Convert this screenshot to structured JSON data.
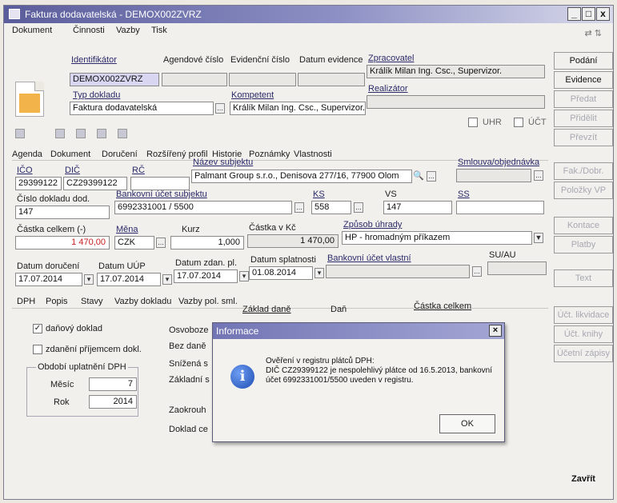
{
  "window": {
    "title": "Faktura dodavatelská - DEMOX002ZVRZ",
    "controls": [
      "_",
      "□",
      "x"
    ]
  },
  "menu": [
    "Dokument",
    "Činnosti",
    "Vazby",
    "Tisk"
  ],
  "header": {
    "identifikator_label": "Identifikátor",
    "identifikator_value": "DEMOX002ZVRZ",
    "agendove_cislo_label": "Agendové číslo",
    "agendove_cislo_value": "",
    "evidencni_cislo_label": "Evidenční číslo",
    "evidencni_cislo_value": "",
    "datum_evidence_label": "Datum evidence",
    "datum_evidence_value": "",
    "zpracovatel_label": "Zpracovatel",
    "zpracovatel_value": "Králík Milan Ing. Csc., Supervizor.",
    "typ_dokladu_label": "Typ dokladu",
    "typ_dokladu_value": "Faktura dodavatelská",
    "kompetent_label": "Kompetent",
    "kompetent_value": "Králík Milan Ing. Csc., Supervizor.",
    "realizator_label": "Realizátor",
    "realizator_value": "",
    "uhr_label": "UHR",
    "uct_label": "ÚČT"
  },
  "right_buttons": [
    {
      "label": "Podání",
      "enabled": true
    },
    {
      "label": "Evidence",
      "enabled": true
    },
    {
      "label": "Předat",
      "enabled": false
    },
    {
      "label": "Přidělit",
      "enabled": false
    },
    {
      "label": "Převzít",
      "enabled": false
    },
    {
      "label": "Fak./Dobr.",
      "enabled": false
    },
    {
      "label": "Položky VP",
      "enabled": false
    },
    {
      "label": "Kontace",
      "enabled": false
    },
    {
      "label": "Platby",
      "enabled": false
    },
    {
      "label": "Text",
      "enabled": false
    },
    {
      "label": "Účt. likvidace",
      "enabled": false
    },
    {
      "label": "Účt. knihy",
      "enabled": false
    },
    {
      "label": "Účetní zápisy",
      "enabled": false
    },
    {
      "label": "Zavřít",
      "enabled": true
    }
  ],
  "tabs": [
    "Agenda",
    "Dokument",
    "Doručení",
    "Rozšířený profil",
    "Historie",
    "Poznámky",
    "Vlastnosti"
  ],
  "form": {
    "ico_label": "IČO",
    "ico_value": "29399122",
    "dic_label": "DIČ",
    "dic_value": "CZ29399122",
    "rc_label": "RČ",
    "rc_value": "",
    "nazev_label": "Název subjektu",
    "nazev_value": "Palmant Group s.r.o., Denisova 277/16, 77900 Olom",
    "smlouva_label": "Smlouva/objednávka",
    "smlouva_value": "",
    "cislo_dokladu_label": "Číslo dokladu dod.",
    "cislo_dokladu_value": "147",
    "bankovni_ucet_label": "Bankovní účet subjektu",
    "bankovni_ucet_value": "6992331001 / 5500",
    "ks_label": "KS",
    "ks_value": "558",
    "vs_label": "VS",
    "vs_value": "147",
    "ss_label": "SS",
    "ss_value": "",
    "castka_celkem_label": "Částka celkem (-)",
    "castka_celkem_value": "1 470,00",
    "mena_label": "Měna",
    "mena_value": "CZK",
    "kurz_label": "Kurz",
    "kurz_value": "1,000",
    "castka_kc_label": "Částka v Kč",
    "castka_kc_value": "1 470,00",
    "zpusob_uhrady_label": "Způsob úhrady",
    "zpusob_uhrady_value": "HP - hromadným příkazem",
    "datum_doruceni_label": "Datum doručení",
    "datum_doruceni_value": "17.07.2014",
    "datum_uup_label": "Datum UÚP",
    "datum_uup_value": "17.07.2014",
    "datum_zdan_label": "Datum zdan. pl.",
    "datum_zdan_value": "17.07.2014",
    "datum_splatnosti_label": "Datum splatnosti",
    "datum_splatnosti_value": "01.08.2014",
    "bankovni_ucet_vlastni_label": "Bankovní účet vlastní",
    "bankovni_ucet_vlastni_value": "",
    "su_au_label": "SU/AU",
    "su_au_value": ""
  },
  "subtabs": [
    "DPH",
    "Popis",
    "Stavy",
    "Vazby dokladu",
    "Vazby pol. sml."
  ],
  "dph": {
    "danovy_doklad_label": "daňový doklad",
    "danovy_doklad_checked": true,
    "zdaneni_label": "zdanění příjemcem dokl.",
    "zdaneni_checked": false,
    "obdobi_label": "Období uplatnění DPH",
    "mesic_label": "Měsíc",
    "mesic_value": "7",
    "rok_label": "Rok",
    "rok_value": "2014",
    "col_zaklad": "Základ daně",
    "col_dan": "Daň",
    "col_castka": "Částka celkem",
    "rows": [
      "Osvoboze",
      "Bez daně",
      "Snížená s",
      "Základní s",
      "Zaokrouh",
      "Doklad ce"
    ]
  },
  "dialog": {
    "title": "Informace",
    "line1": "Ověření v registru plátců DPH:",
    "line2": "DIČ CZ29399122 je nespolehlivý plátce od  16.5.2013, bankovní",
    "line3": "účet 6992331001/5500 uveden v registru.",
    "ok_label": "OK"
  }
}
